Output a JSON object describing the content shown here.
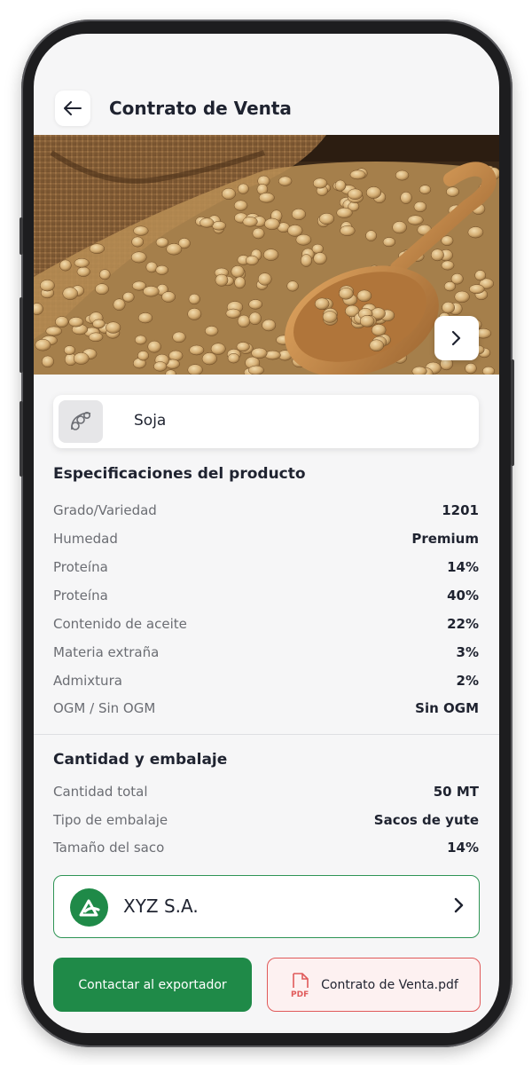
{
  "header": {
    "title": "Contrato de Venta",
    "back_icon": "arrow-left-icon"
  },
  "hero": {
    "image": "soybeans-burlap-sack-wooden-spoon",
    "next_icon": "chevron-right-icon"
  },
  "product": {
    "name": "Soja",
    "icon": "soybean-icon"
  },
  "specs": {
    "title": "Especificaciones del producto",
    "rows": [
      {
        "label": "Grado/Variedad",
        "value": "1201"
      },
      {
        "label": "Humedad",
        "value": "Premium"
      },
      {
        "label": "Proteína",
        "value": "14%"
      },
      {
        "label": "Proteína",
        "value": "40%"
      },
      {
        "label": "Contenido de aceite",
        "value": "22%"
      },
      {
        "label": "Materia extraña",
        "value": "3%"
      },
      {
        "label": "Admixtura",
        "value": "2%"
      },
      {
        "label": "OGM / Sin OGM",
        "value": "Sin OGM"
      }
    ]
  },
  "packaging": {
    "title": "Cantidad y embalaje",
    "rows": [
      {
        "label": "Cantidad total",
        "value": "50 MT"
      },
      {
        "label": "Tipo de embalaje",
        "value": "Sacos de yute"
      },
      {
        "label": "Tamaño del saco",
        "value": "14%"
      }
    ]
  },
  "exporter": {
    "name": "XYZ S.A.",
    "logo_icon": "company-logo-icon",
    "chevron_icon": "chevron-right-icon"
  },
  "actions": {
    "contact_label": "Contactar al exportador",
    "pdf_label": "Contrato de Venta.pdf",
    "pdf_icon": "pdf-file-icon"
  },
  "colors": {
    "accent": "#1f8a48",
    "pdf_accent": "#e05a5a",
    "text": "#1f2330",
    "muted": "#6b6d73"
  }
}
